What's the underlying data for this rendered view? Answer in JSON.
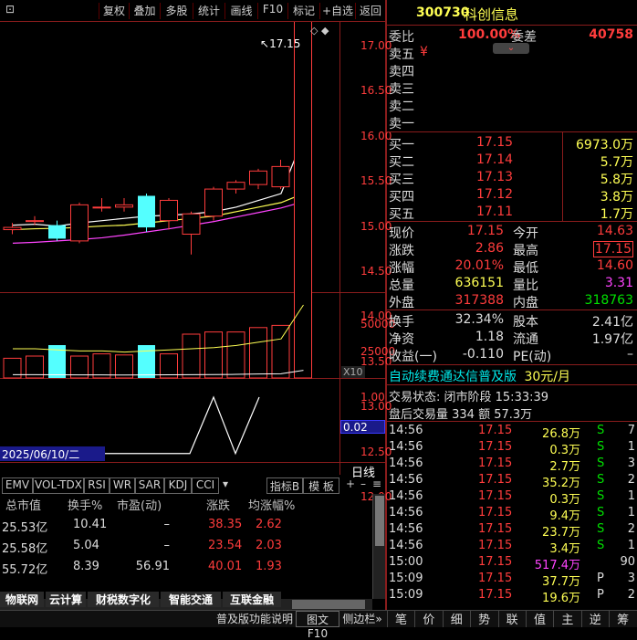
{
  "toolbar": {
    "buttons": [
      "复权",
      "叠加",
      "多股",
      "统计",
      "画线",
      "F10",
      "标记",
      "+自选",
      "返回"
    ]
  },
  "chart": {
    "price_axis": [
      "17.00",
      "16.50",
      "16.00",
      "15.50",
      "15.00",
      "14.50",
      "14.00",
      "13.50",
      "13.00",
      "12.50",
      "12.00"
    ],
    "high_label": "17.15",
    "vol_axis": [
      "50000",
      "25000"
    ],
    "vol_mult": "X10",
    "ind_axis": [
      "1.00",
      "0.50"
    ],
    "ind_value": "0.02",
    "date_label": "2025/06/10/二",
    "period": "日线"
  },
  "chart_data": {
    "type": "candlestick",
    "candles": [
      {
        "o": 12.95,
        "h": 13.05,
        "l": 12.8,
        "c": 12.9,
        "color": "red"
      },
      {
        "o": 13.1,
        "h": 13.2,
        "l": 13.0,
        "c": 13.1,
        "color": "red"
      },
      {
        "o": 13.0,
        "h": 13.1,
        "l": 12.65,
        "c": 12.7,
        "color": "cyan"
      },
      {
        "o": 12.65,
        "h": 13.5,
        "l": 12.6,
        "c": 13.45,
        "color": "red"
      },
      {
        "o": 13.4,
        "h": 13.6,
        "l": 13.3,
        "c": 13.4,
        "color": "red"
      },
      {
        "o": 13.45,
        "h": 13.6,
        "l": 13.3,
        "c": 13.4,
        "color": "red"
      },
      {
        "o": 13.65,
        "h": 13.7,
        "l": 12.85,
        "c": 12.95,
        "color": "cyan"
      },
      {
        "o": 13.1,
        "h": 13.6,
        "l": 12.9,
        "c": 13.55,
        "color": "red"
      },
      {
        "o": 13.25,
        "h": 13.3,
        "l": 12.35,
        "c": 12.8,
        "color": "red"
      },
      {
        "o": 13.2,
        "h": 13.85,
        "l": 13.1,
        "c": 13.8,
        "color": "red"
      },
      {
        "o": 13.8,
        "h": 14.0,
        "l": 13.7,
        "c": 13.95,
        "color": "red"
      },
      {
        "o": 13.9,
        "h": 14.25,
        "l": 13.8,
        "c": 14.2,
        "color": "red"
      },
      {
        "o": 13.85,
        "h": 14.45,
        "l": 13.8,
        "c": 14.3,
        "color": "red"
      },
      {
        "o": 14.63,
        "h": 17.15,
        "l": 14.6,
        "c": 17.15,
        "color": "red"
      }
    ],
    "volume": [
      1800,
      2000,
      3000,
      2000,
      2200,
      2100,
      3000,
      2200,
      4000,
      4200,
      4200,
      4600,
      4800,
      63600
    ],
    "ma5": [
      13.0,
      13.02,
      12.98,
      13.05,
      13.1,
      13.15,
      13.2,
      13.22,
      13.25,
      13.3,
      13.4,
      13.55,
      13.7,
      14.95
    ],
    "ma10": [
      12.9,
      12.92,
      12.93,
      12.95,
      12.98,
      13.0,
      13.05,
      13.1,
      13.15,
      13.2,
      13.3,
      13.4,
      13.5,
      13.7
    ],
    "ma20": [
      12.6,
      12.62,
      12.65,
      12.68,
      12.72,
      12.78,
      12.85,
      12.92,
      13.0,
      13.08,
      13.18,
      13.28,
      13.38,
      13.52
    ],
    "indicator": [
      0.02,
      0.02,
      0.02,
      0.02,
      0.02,
      0.02,
      0.02,
      0.02,
      0.02,
      0.02,
      1.0,
      0.02,
      1.0
    ]
  },
  "indicator_tabs": [
    "EMV",
    "VOL-TDX",
    "RSI",
    "WR",
    "SAR",
    "KDJ",
    "CCI"
  ],
  "indicator_btn": "指标B",
  "template_btn": "模 板",
  "sector_table": {
    "headers": [
      "总市值",
      "换手%",
      "市盈(动)",
      "涨跌",
      "均涨幅%"
    ],
    "rows": [
      [
        "25.53亿",
        "10.41",
        "–",
        "38.35",
        "2.62"
      ],
      [
        "25.58亿",
        "5.04",
        "–",
        "23.54",
        "2.03"
      ],
      [
        "55.72亿",
        "8.39",
        "56.91",
        "40.01",
        "1.93"
      ]
    ]
  },
  "sector_tabs": [
    "物联网",
    "云计算",
    "财税数字化",
    "智能交通",
    "互联金融"
  ],
  "bottom": {
    "help": "普及版功能说明",
    "f10": "图文F10",
    "sidebar": "侧边栏»"
  },
  "stock": {
    "code": "300730",
    "name": "科创信息"
  },
  "weibi": {
    "label": "委比",
    "value": "100.00%",
    "diff_label": "委差",
    "diff_value": "40758"
  },
  "asks": [
    {
      "label": "卖五",
      "price": "¥",
      "vol": ""
    },
    {
      "label": "卖四",
      "price": "",
      "vol": ""
    },
    {
      "label": "卖三",
      "price": "",
      "vol": ""
    },
    {
      "label": "卖二",
      "price": "",
      "vol": ""
    },
    {
      "label": "卖一",
      "price": "",
      "vol": ""
    }
  ],
  "bids": [
    {
      "label": "买一",
      "price": "17.15",
      "vol": "6973.0万"
    },
    {
      "label": "买二",
      "price": "17.14",
      "vol": "5.7万"
    },
    {
      "label": "买三",
      "price": "17.13",
      "vol": "5.8万"
    },
    {
      "label": "买四",
      "price": "17.12",
      "vol": "3.8万"
    },
    {
      "label": "买五",
      "price": "17.11",
      "vol": "1.7万"
    }
  ],
  "quote": [
    {
      "l1": "现价",
      "v1": "17.15",
      "l2": "今开",
      "v2": "14.63"
    },
    {
      "l1": "涨跌",
      "v1": "2.86",
      "l2": "最高",
      "v2": "17.15"
    },
    {
      "l1": "涨幅",
      "v1": "20.01%",
      "l2": "最低",
      "v2": "14.60"
    },
    {
      "l1": "总量",
      "v1": "636151",
      "l2": "量比",
      "v2": "3.31"
    },
    {
      "l1": "外盘",
      "v1": "317388",
      "l2": "内盘",
      "v2": "318763"
    }
  ],
  "quote2": [
    {
      "l1": "换手",
      "v1": "32.34%",
      "l2": "股本",
      "v2": "2.41亿"
    },
    {
      "l1": "净资",
      "v1": "1.18",
      "l2": "流通",
      "v2": "1.97亿"
    },
    {
      "l1": "收益(一)",
      "v1": "-0.110",
      "l2": "PE(动)",
      "v2": "–"
    }
  ],
  "promo": {
    "text": "自动续费通达信普及版",
    "price": "30元/月"
  },
  "trade_status": "交易状态: 闭市阶段 15:33:39",
  "after_hours": "盘后交易量 334 额 57.3万",
  "ticks": [
    {
      "t": "14:56",
      "p": "17.15",
      "v": "26.8万",
      "s": "S",
      "n": "7"
    },
    {
      "t": "14:56",
      "p": "17.15",
      "v": "0.3万",
      "s": "S",
      "n": "1"
    },
    {
      "t": "14:56",
      "p": "17.15",
      "v": "2.7万",
      "s": "S",
      "n": "3"
    },
    {
      "t": "14:56",
      "p": "17.15",
      "v": "35.2万",
      "s": "S",
      "n": "2"
    },
    {
      "t": "14:56",
      "p": "17.15",
      "v": "0.3万",
      "s": "S",
      "n": "1"
    },
    {
      "t": "14:56",
      "p": "17.15",
      "v": "9.4万",
      "s": "S",
      "n": "1"
    },
    {
      "t": "14:56",
      "p": "17.15",
      "v": "23.7万",
      "s": "S",
      "n": "2"
    },
    {
      "t": "14:56",
      "p": "17.15",
      "v": "3.4万",
      "s": "S",
      "n": "1"
    },
    {
      "t": "15:00",
      "p": "17.15",
      "v": "517.4万",
      "s": "",
      "n": "90"
    },
    {
      "t": "15:09",
      "p": "17.15",
      "v": "37.7万",
      "s": "P",
      "n": "3"
    },
    {
      "t": "15:09",
      "p": "17.15",
      "v": "19.6万",
      "s": "P",
      "n": "2"
    }
  ],
  "right_tabs": [
    "笔",
    "价",
    "细",
    "势",
    "联",
    "值",
    "主",
    "逆",
    "筹"
  ]
}
